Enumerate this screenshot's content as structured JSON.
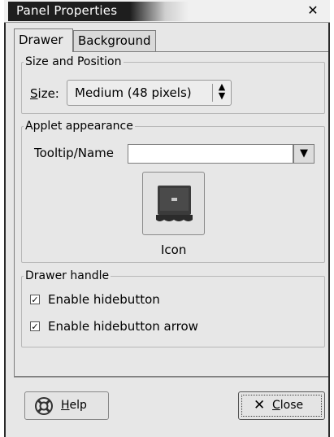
{
  "window": {
    "title": "Panel Properties"
  },
  "tabs": [
    {
      "label": "Drawer",
      "active": true
    },
    {
      "label": "Background",
      "active": false
    }
  ],
  "size_position": {
    "heading": "Size and Position",
    "size_label_first": "S",
    "size_label_rest": "ize:",
    "size_value": "Medium (48 pixels)"
  },
  "applet": {
    "heading": "Applet appearance",
    "tooltip_label": "Tooltip/Name",
    "tooltip_value": "",
    "icon_label": "Icon"
  },
  "drawer_handle": {
    "heading": "Drawer handle",
    "options": [
      {
        "label": "Enable hidebutton",
        "checked": true
      },
      {
        "label": "Enable hidebutton arrow",
        "checked": true
      }
    ]
  },
  "buttons": {
    "help_first": "H",
    "help_rest": "elp",
    "close_first": "C",
    "close_rest": "lose"
  },
  "icons": {
    "close_window": "close-icon",
    "help": "lifebuoy-icon",
    "applet": "drawer-icon",
    "close_button": "x-icon"
  }
}
